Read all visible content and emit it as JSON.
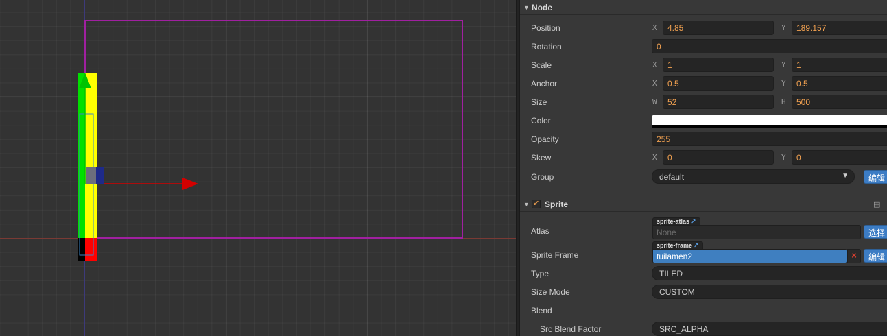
{
  "scene": {
    "colors": {
      "background": "#333333",
      "bounds": "#a020a0",
      "x_axis_line": "#7a3a34",
      "y_axis_line": "#3d3a7a",
      "x_arrow": "#d40000",
      "y_arrow": "#00c400",
      "sprite_fill": "#ffff00"
    }
  },
  "inspector": {
    "node_section": {
      "title": "Node",
      "toggle_icon": "triangle-down-icon",
      "position": {
        "label": "Position",
        "x_axis": "X",
        "x": "4.85",
        "y_axis": "Y",
        "y": "189.157"
      },
      "rotation": {
        "label": "Rotation",
        "value": "0"
      },
      "scale": {
        "label": "Scale",
        "x_axis": "X",
        "x": "1",
        "y_axis": "Y",
        "y": "1"
      },
      "anchor": {
        "label": "Anchor",
        "x_axis": "X",
        "x": "0.5",
        "y_axis": "Y",
        "y": "0.5"
      },
      "size": {
        "label": "Size",
        "w_axis": "W",
        "w": "52",
        "h_axis": "H",
        "h": "500"
      },
      "color": {
        "label": "Color",
        "value": "#ffffff"
      },
      "opacity": {
        "label": "Opacity",
        "value": "255"
      },
      "skew": {
        "label": "Skew",
        "x_axis": "X",
        "x": "0",
        "y_axis": "Y",
        "y": "0"
      },
      "group": {
        "label": "Group",
        "value": "default",
        "edit_button": "编辑"
      }
    },
    "sprite_section": {
      "title": "Sprite",
      "enabled": true,
      "help_icon": "book-icon",
      "atlas": {
        "label": "Atlas",
        "tag": "sprite-atlas",
        "value": "None",
        "select_button": "选择"
      },
      "sprite_frame": {
        "label": "Sprite Frame",
        "tag": "sprite-frame",
        "value": "tuilamen2",
        "clear_icon": "close-icon",
        "edit_button": "编辑"
      },
      "type": {
        "label": "Type",
        "value": "TILED"
      },
      "size_mode": {
        "label": "Size Mode",
        "value": "CUSTOM"
      },
      "blend": {
        "label": "Blend"
      },
      "src_blend": {
        "label": "Src Blend Factor",
        "value": "SRC_ALPHA"
      }
    }
  }
}
